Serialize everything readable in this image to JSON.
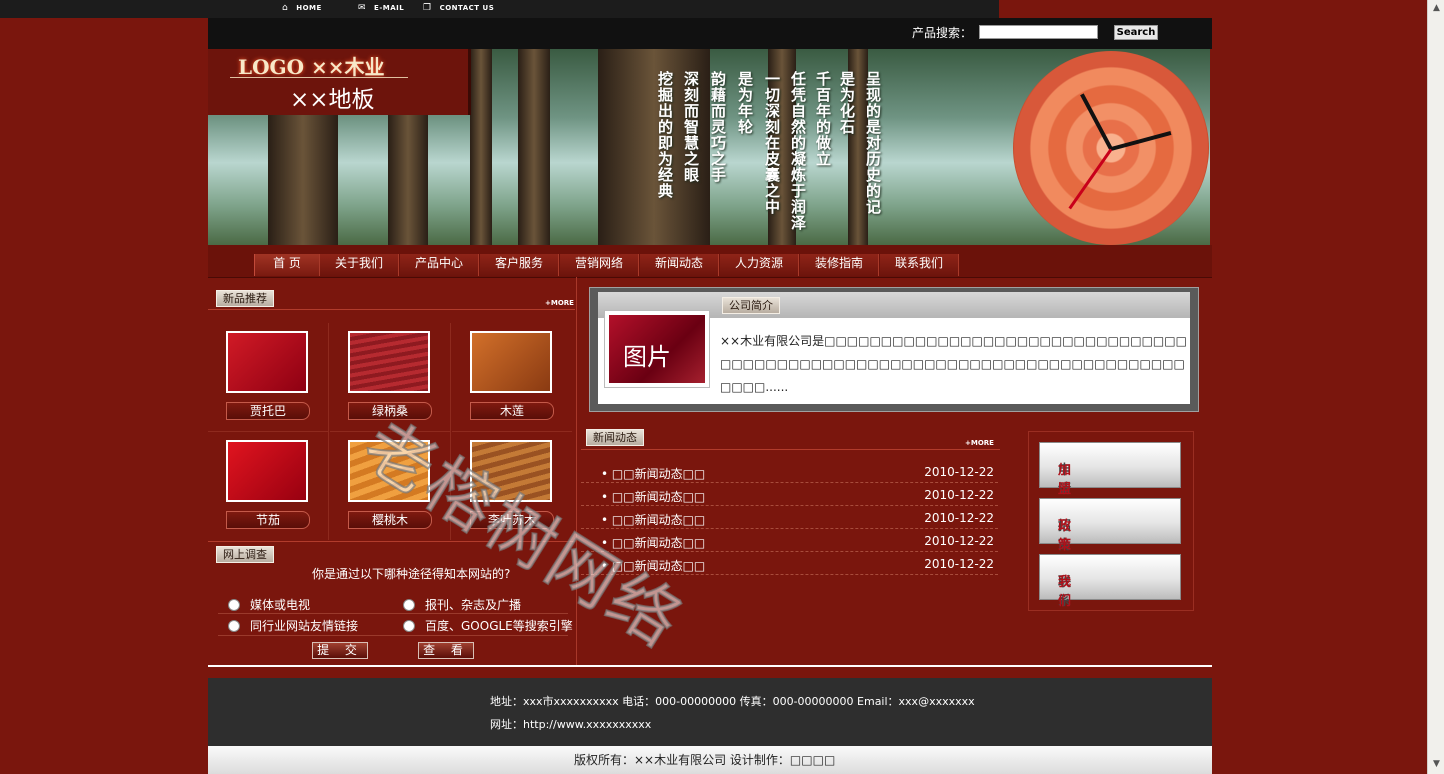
{
  "top_links": {
    "home": "HOME",
    "email": "E-MAIL",
    "contact": "CONTACT US"
  },
  "search": {
    "label": "产品搜索：",
    "button": "Search"
  },
  "logo": {
    "title": "LOGO  ××木业",
    "subtitle": "××地板"
  },
  "banner": {
    "poem": [
      "呈现的是对历史的记",
      "是为化石",
      "千百年的做立",
      "任凭自然的凝炼于润泽",
      "一切深刻在皮囊之中",
      "是为年轮",
      "韵藉而灵巧之手",
      "深刻而智慧之眼",
      "挖掘出的即为经典"
    ]
  },
  "nav": {
    "items": [
      "首 页",
      "关于我们",
      "产品中心",
      "客户服务",
      "营销网络",
      "新闻动态",
      "人力资源",
      "装修指南",
      "联系我们"
    ]
  },
  "new_products": {
    "title": "新品推荐",
    "more": "+MORE",
    "items": [
      {
        "name": "贾托巴",
        "color": "#b00d1c"
      },
      {
        "name": "绿柄桑",
        "color": "#a8222a"
      },
      {
        "name": "木莲",
        "color": "#b8541e"
      },
      {
        "name": "节茄",
        "color": "#c2101f"
      },
      {
        "name": "樱桃木",
        "color": "#e88a2c"
      },
      {
        "name": "李叶苏木",
        "color": "#a8602a"
      }
    ]
  },
  "poll": {
    "title": "网上调查",
    "question": "你是通过以下哪种途径得知本网站的?",
    "options": [
      "媒体或电视",
      "报刊、杂志及广播",
      "同行业网站友情链接",
      "百度、GOOGLE等搜索引擎"
    ],
    "submit": "提 交",
    "view": "查 看"
  },
  "about": {
    "title": "公司简介",
    "image_label": "图片",
    "text": "××木业有限公司是□□□□□□□□□□□□□□□□□□□□□□□□□□□□□□□□□□□□□□□□□□□□□□□□□□□□□□□□□□□□□□□□□□□□□□□□□□□□□......"
  },
  "news": {
    "title": "新闻动态",
    "more": "+MORE",
    "items": [
      {
        "title": "□□新闻动态□□",
        "date": "2010-12-22"
      },
      {
        "title": "□□新闻动态□□",
        "date": "2010-12-22"
      },
      {
        "title": "□□新闻动态□□",
        "date": "2010-12-22"
      },
      {
        "title": "□□新闻动态□□",
        "date": "2010-12-22"
      },
      {
        "title": "□□新闻动态□□",
        "date": "2010-12-22"
      }
    ]
  },
  "side_links": [
    {
      "a": "申请",
      "b": "加盟"
    },
    {
      "a": "招商",
      "b": "政策"
    },
    {
      "a": "联系",
      "b": "我们"
    }
  ],
  "footer": {
    "address": "地址：xxx市xxxxxxxxxx 电话：000-00000000 传真：000-00000000 Email：xxx@xxxxxxx",
    "website": "网址：http://www.xxxxxxxxxx",
    "copyright": "版权所有：××木业有限公司 设计制作：□□□□"
  },
  "watermark": "老榕树网络",
  "colors": {
    "brand_red": "#7a160d",
    "accent_red": "#a8222a"
  }
}
